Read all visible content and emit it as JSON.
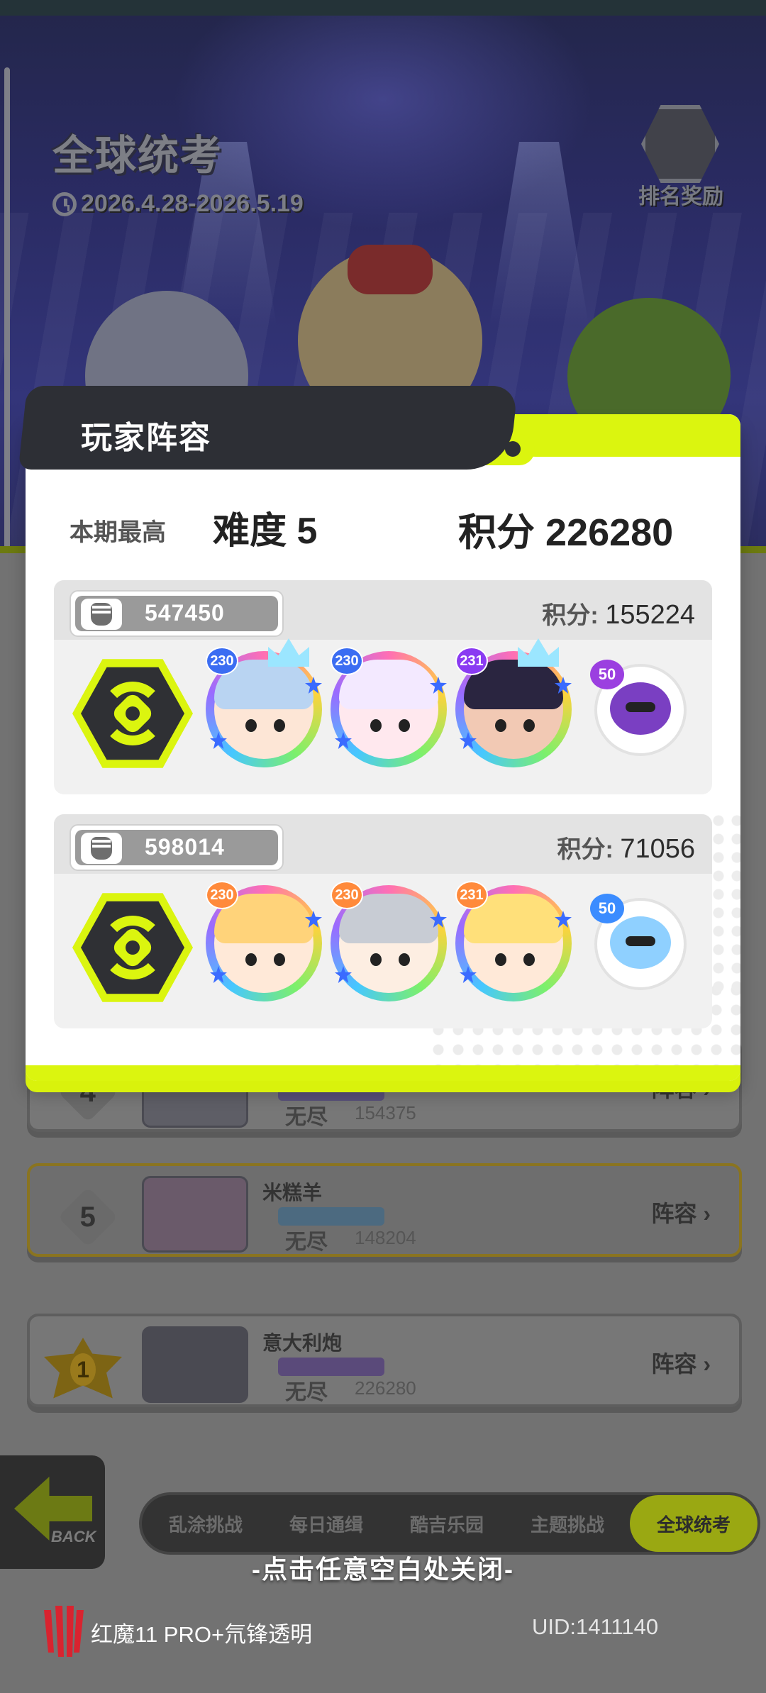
{
  "background": {
    "event_title": "全球统考",
    "event_date": "2026.4.28-2026.5.19",
    "reward_label": "排名奖励",
    "ranking_rows": [
      {
        "rank": "4",
        "name": "",
        "mode": "无尽",
        "score": "154375",
        "lineup_label": "阵容",
        "highlight": false
      },
      {
        "rank": "5",
        "name": "米糕羊",
        "mode": "无尽",
        "score": "148204",
        "lineup_label": "阵容",
        "highlight": true
      },
      {
        "rank": "1",
        "name": "意大利炮",
        "mode": "无尽",
        "score": "226280",
        "lineup_label": "阵容",
        "highlight": false
      }
    ],
    "back_label": "BACK",
    "nav_tabs": [
      "乱涂挑战",
      "每日通缉",
      "酷吉乐园",
      "主题挑战",
      "全球统考"
    ],
    "nav_active_index": 4
  },
  "panel": {
    "title": "玩家阵容",
    "best_label": "本期最高",
    "best_difficulty": "难度 5",
    "best_score": "积分 226280",
    "teams": [
      {
        "team_id": "547450",
        "score_label": "积分:",
        "score": "155224",
        "heroes": [
          {
            "level": "230",
            "hair": "#b9d4f2",
            "skin": "#fde6d6",
            "accent": "#3b6df2",
            "crown": true
          },
          {
            "level": "230",
            "hair": "#f3e9ff",
            "skin": "#ffe8ee",
            "accent": "#3b6df2",
            "crown": false
          },
          {
            "level": "231",
            "hair": "#2a2540",
            "skin": "#f2c9b4",
            "accent": "#8a3bf2",
            "crown": true
          }
        ],
        "pet": {
          "level": "50",
          "body": "#7a3fc2",
          "badge": "#9b3fe0"
        }
      },
      {
        "team_id": "598014",
        "score_label": "积分:",
        "score": "71056",
        "heroes": [
          {
            "level": "230",
            "hair": "#ffd37a",
            "skin": "#ffe9d8",
            "accent": "#ff8a3b",
            "crown": false
          },
          {
            "level": "230",
            "hair": "#c8ccd4",
            "skin": "#fdeee2",
            "accent": "#ff8a3b",
            "crown": false
          },
          {
            "level": "231",
            "hair": "#ffe07a",
            "skin": "#ffe9d8",
            "accent": "#ff8a3b",
            "crown": false
          }
        ],
        "pet": {
          "level": "50",
          "body": "#8fd0ff",
          "badge": "#3b8cff"
        }
      }
    ]
  },
  "footer": {
    "close_hint": "-点击任意空白处关闭-",
    "watermark": "红魔11 PRO+氘锋透明",
    "uid": "UID:1411140"
  },
  "colors": {
    "accent_lime": "#dbf50f",
    "panel_dark": "#2d2f35",
    "dim_overlay": "#727272"
  }
}
